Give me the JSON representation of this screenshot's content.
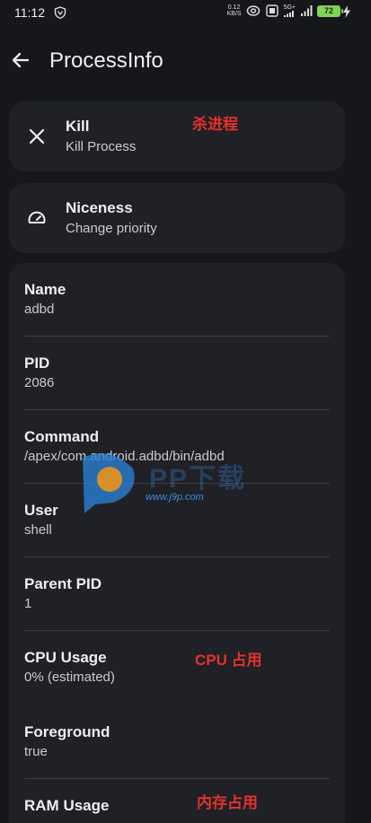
{
  "status_bar": {
    "time": "11:12",
    "net_speed": "0.12",
    "net_speed_unit": "KB/S",
    "network": "5G+",
    "battery": "72"
  },
  "app_bar": {
    "title": "ProcessInfo"
  },
  "actions": [
    {
      "title": "Kill",
      "subtitle": "Kill Process",
      "icon": "close-icon"
    },
    {
      "title": "Niceness",
      "subtitle": "Change priority",
      "icon": "gauge-icon"
    }
  ],
  "info": [
    {
      "label": "Name",
      "value": "adbd"
    },
    {
      "label": "PID",
      "value": "2086"
    },
    {
      "label": "Command",
      "value": "/apex/com.android.adbd/bin/adbd"
    },
    {
      "label": "User",
      "value": "shell"
    },
    {
      "label": "Parent PID",
      "value": "1"
    },
    {
      "label": "CPU Usage",
      "value": "0% (estimated)"
    },
    {
      "label": "Foreground",
      "value": "true"
    },
    {
      "label": "RAM Usage",
      "value": ""
    }
  ],
  "annotations": {
    "kill": "杀进程",
    "cpu": "CPU 占用",
    "ram": "内存占用"
  },
  "watermark": {
    "url": "www.j9p.com",
    "brand": "PP下载"
  },
  "colors": {
    "background": "#16171b",
    "card": "#1f2126",
    "annotation": "#e5312b",
    "battery": "#7fd35a"
  }
}
